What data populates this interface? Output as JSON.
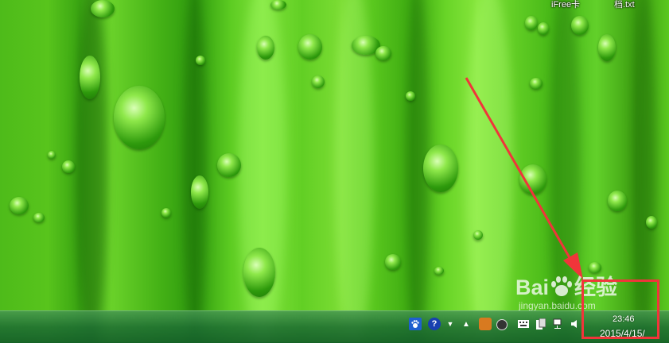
{
  "desktop": {
    "icons": [
      {
        "label": "iFree卡"
      },
      {
        "label": "档.txt"
      }
    ]
  },
  "watermark": {
    "brand": "Bai",
    "brand_end": "经验",
    "url": "jingyan.baidu.com"
  },
  "taskbar": {
    "tray_icons": [
      "baidu-paw-icon",
      "help-icon",
      "expand-arrow-icon",
      "app-tray-icon",
      "camera-icon",
      "keyboard-icon",
      "phone-icon",
      "network-icon",
      "volume-icon"
    ],
    "clock_time": "23:46",
    "clock_date": "2015/4/15/"
  },
  "colors": {
    "annotation": "#f0353a",
    "wallpaper": "#4ebb1a"
  }
}
